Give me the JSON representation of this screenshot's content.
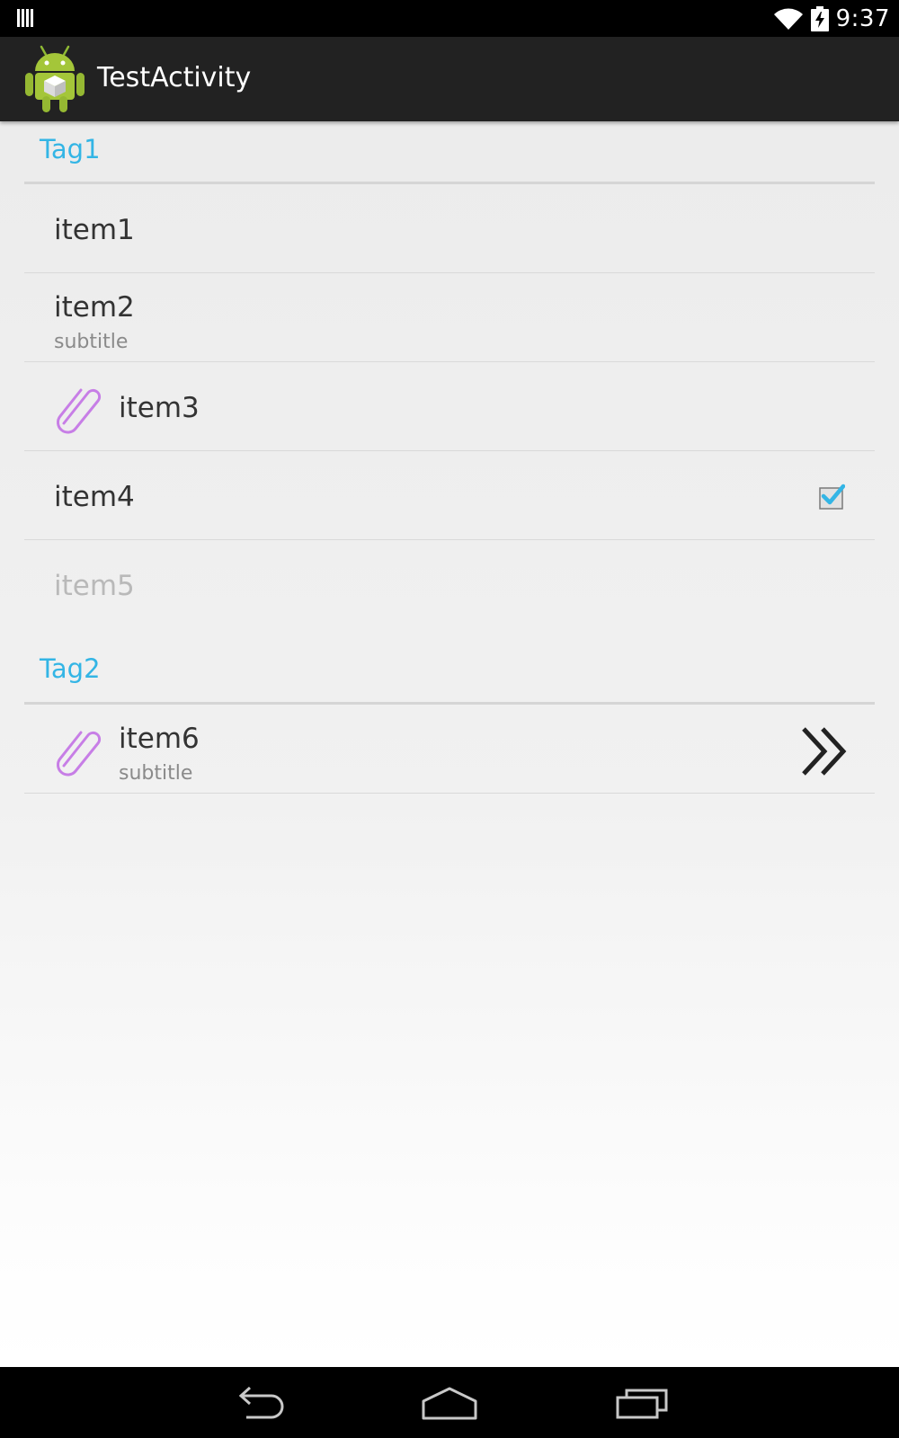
{
  "status_bar": {
    "time": "9:37",
    "left_icon": "sim-signal-icon",
    "wifi_icon": "wifi-icon",
    "battery_icon": "battery-charging-icon"
  },
  "action_bar": {
    "logo_icon": "android-app-icon",
    "title": "TestActivity"
  },
  "preferences": {
    "categories": [
      {
        "title": "Tag1",
        "items": [
          {
            "title": "item1"
          },
          {
            "title": "item2",
            "subtitle": "subtitle"
          },
          {
            "title": "item3",
            "icon": "paperclip-icon"
          },
          {
            "title": "item4",
            "checked": true
          },
          {
            "title": "item5",
            "enabled": false
          }
        ]
      },
      {
        "title": "Tag2",
        "items": [
          {
            "title": "item6",
            "subtitle": "subtitle",
            "icon": "paperclip-icon",
            "widget": "double-chevron-right-icon"
          }
        ]
      }
    ]
  },
  "nav_bar": {
    "back_icon": "back-icon",
    "home_icon": "home-icon",
    "recent_icon": "recent-apps-icon"
  },
  "colors": {
    "accent": "#33b5e5",
    "action_bar_bg": "#222222",
    "icon_tint": "#c77ee6",
    "disabled_text": "#b9b9b9"
  }
}
